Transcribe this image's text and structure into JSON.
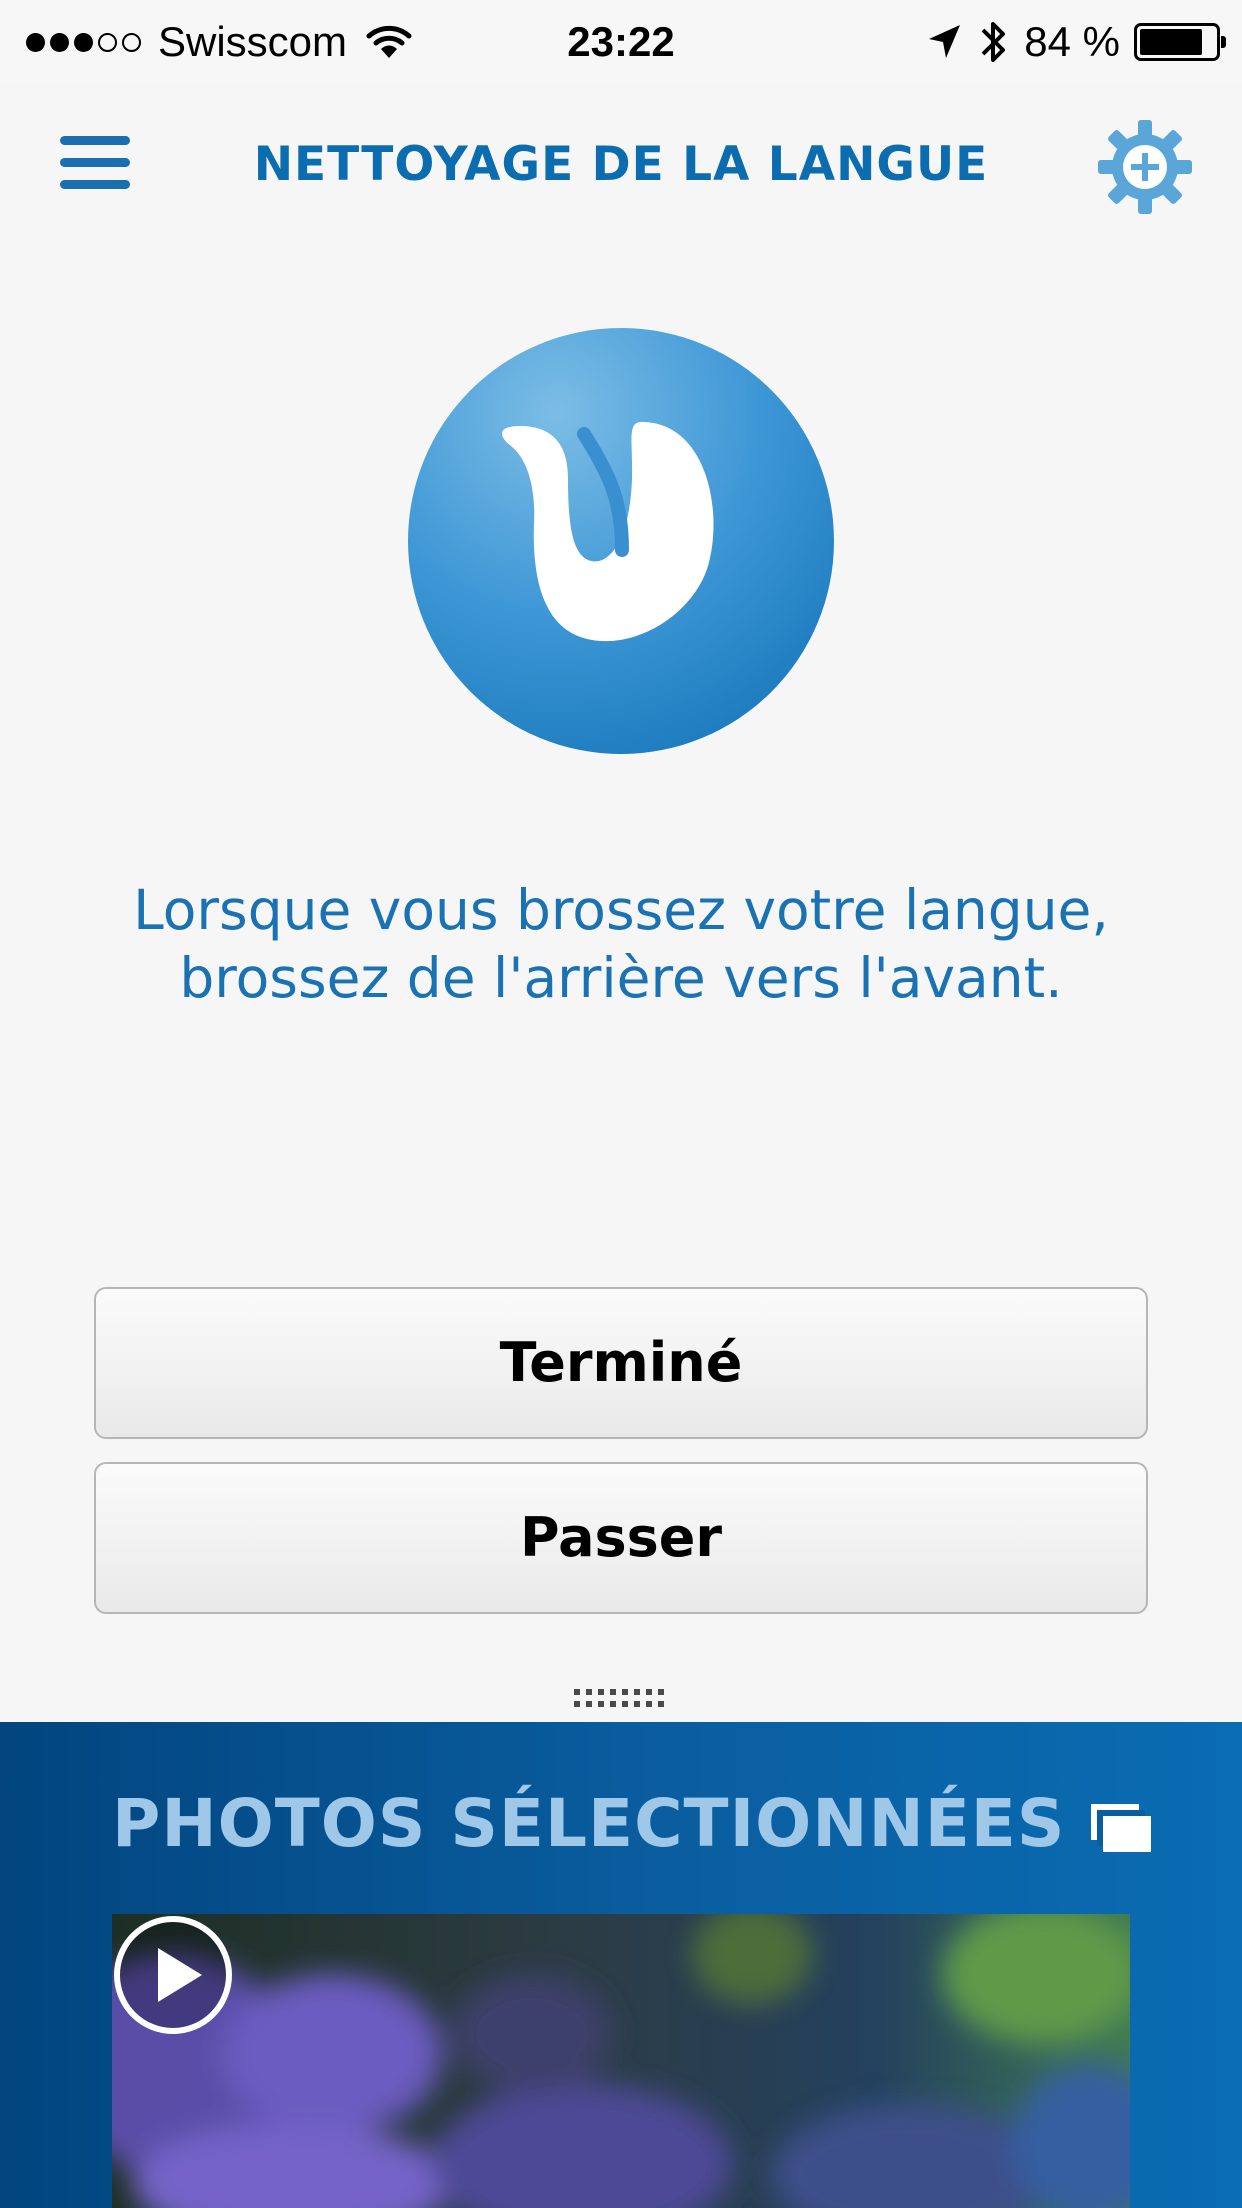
{
  "status_bar": {
    "signal_dots_filled": 3,
    "signal_dots_total": 5,
    "carrier": "Swisscom",
    "time": "23:22",
    "battery_text": "84 %",
    "battery_level": 0.84,
    "icons": [
      "signal-dots-icon",
      "wifi-icon",
      "location-arrow-icon",
      "bluetooth-icon",
      "battery-icon"
    ]
  },
  "nav": {
    "title": "NETTOYAGE DE LA LANGUE",
    "left_icon": "hamburger-menu-icon",
    "right_icon": "settings-gear-plus-icon"
  },
  "main": {
    "hero_icon": "tongue-icon",
    "instruction": "Lorsque vous brossez votre langue, brossez de l'arrière vers l'avant.",
    "buttons": {
      "done": "Terminé",
      "skip": "Passer"
    },
    "handle_icon": "drag-handle-icon"
  },
  "photos": {
    "title": "PHOTOS SÉLECTIONNÉES",
    "stack_icon": "photo-stack-icon",
    "play_icon": "play-icon"
  },
  "colors": {
    "accent": "#0b6db0",
    "hero_circle": "#2f8bcc",
    "panel_dark": "#02457f",
    "panel_light": "#0a6cb3",
    "panel_title": "#9ec7e8",
    "background": "#f6f6f6"
  }
}
